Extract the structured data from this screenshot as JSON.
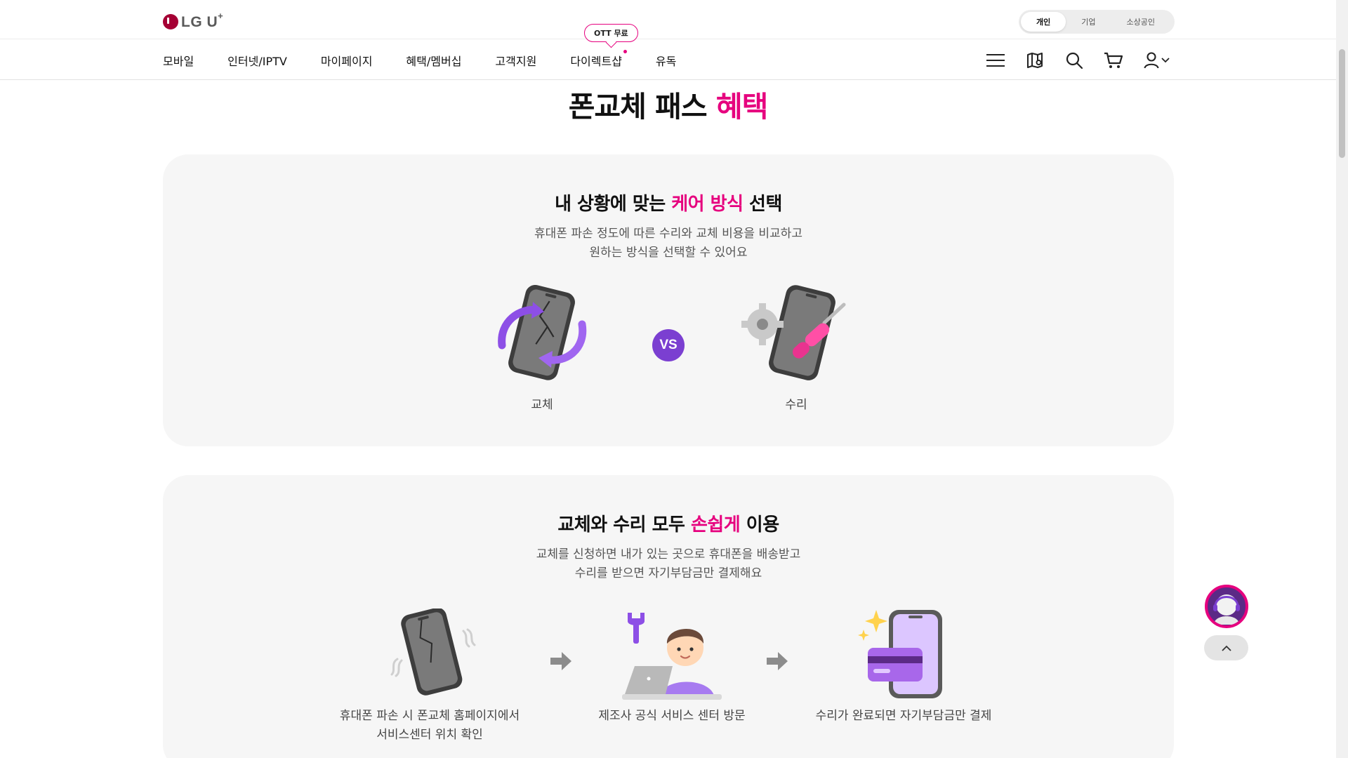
{
  "header": {
    "logo_text": "LG U",
    "logo_sup": "+",
    "segments": [
      {
        "label": "개인",
        "active": true
      },
      {
        "label": "기업",
        "active": false
      },
      {
        "label": "소상공인",
        "active": false
      }
    ],
    "nav": [
      {
        "label": "모바일"
      },
      {
        "label": "인터넷/IPTV"
      },
      {
        "label": "마이페이지"
      },
      {
        "label": "혜택/멤버십"
      },
      {
        "label": "고객지원"
      },
      {
        "label": "다이렉트샵",
        "new_dot": true
      },
      {
        "label": "유독"
      }
    ],
    "nav_bubble": "OTT 무료",
    "icons": [
      "menu-icon",
      "store-map-icon",
      "search-icon",
      "cart-icon",
      "user-icon",
      "chevron-down-icon"
    ]
  },
  "main": {
    "title_prefix": "폰교체 패스 ",
    "title_highlight": "혜택"
  },
  "section1": {
    "title_prefix": "내 상황에 맞는 ",
    "title_highlight": "케어 방식",
    "title_suffix": " 선택",
    "desc_line1": "휴대폰 파손 정도에 따른 수리와 교체 비용을 비교하고",
    "desc_line2": "원하는 방식을 선택할 수 있어요",
    "option_left": "교체",
    "vs_label": "VS",
    "option_right": "수리"
  },
  "section2": {
    "title_prefix": "교체와 수리 모두 ",
    "title_highlight": "손쉽게",
    "title_suffix": " 이용",
    "desc_line1": "교체를 신청하면 내가 있는 곳으로 휴대폰을 배송받고",
    "desc_line2": "수리를 받으면 자기부담금만 결제해요",
    "steps": [
      {
        "line1": "휴대폰 파손 시 폰교체 홈페이지에서",
        "line2": "서비스센터 위치 확인"
      },
      {
        "line1": "제조사 공식 서비스 센터 방문",
        "line2": ""
      },
      {
        "line1": "수리가 완료되면 자기부담금만 결제",
        "line2": ""
      }
    ]
  },
  "colors": {
    "accent_pink": "#e6007e",
    "accent_purple": "#7b3fd1",
    "card_bg": "#f6f6f6"
  }
}
